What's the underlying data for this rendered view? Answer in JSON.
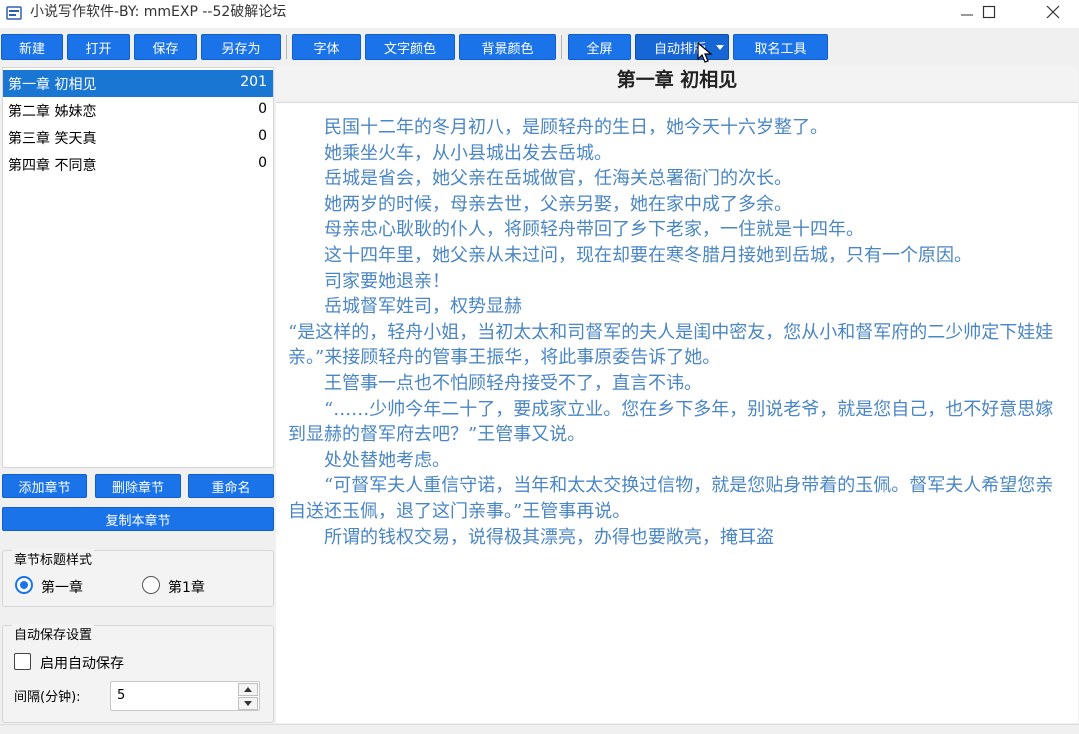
{
  "window": {
    "title": "小说写作软件-BY: mmEXP --52破解论坛"
  },
  "toolbar": {
    "new": "新建",
    "open": "打开",
    "save": "保存",
    "save_as": "另存为",
    "font": "字体",
    "text_color": "文字颜色",
    "bg_color": "背景颜色",
    "fullscreen": "全屏",
    "auto_layout": "自动排版",
    "naming_tool": "取名工具"
  },
  "chapters": [
    {
      "title": "第一章 初相见",
      "count": "201",
      "selected": true
    },
    {
      "title": "第二章 姊妹恋",
      "count": "0",
      "selected": false
    },
    {
      "title": "第三章 笑天真",
      "count": "0",
      "selected": false
    },
    {
      "title": "第四章 不同意",
      "count": "0",
      "selected": false
    }
  ],
  "chapter_actions": {
    "add": "添加章节",
    "delete": "删除章节",
    "rename": "重命名",
    "copy": "复制本章节"
  },
  "title_style": {
    "label": "章节标题样式",
    "option1": "第一章",
    "option2": "第1章",
    "selected": "第一章"
  },
  "autosave": {
    "label": "自动保存设置",
    "enable_label": "启用自动保存",
    "enabled": false,
    "interval_label": "间隔(分钟):",
    "interval_value": "5"
  },
  "editor": {
    "chapter_title": "第一章  初相见",
    "paragraphs": [
      "　　民国十二年的冬月初八，是顾轻舟的生日，她今天十六岁整了。",
      "　　她乘坐火车，从小县城出发去岳城。",
      "　　岳城是省会，她父亲在岳城做官，任海关总署衙门的次长。",
      "　　她两岁的时候，母亲去世，父亲另娶，她在家中成了多余。",
      "　　母亲忠心耿耿的仆人，将顾轻舟带回了乡下老家，一住就是十四年。",
      "　　这十四年里，她父亲从未过问，现在却要在寒冬腊月接她到岳城，只有一个原因。",
      "　　司家要她退亲！",
      "　　岳城督军姓司，权势显赫",
      "“是这样的，轻舟小姐，当初太太和司督军的夫人是闺中密友，您从小和督军府的二少帅定下娃娃亲。”来接顾轻舟的管事王振华，将此事原委告诉了她。",
      "　　王管事一点也不怕顾轻舟接受不了，直言不讳。",
      "　　“……少帅今年二十了，要成家立业。您在乡下多年，别说老爷，就是您自己，也不好意思嫁到显赫的督军府去吧？”王管事又说。",
      "　　处处替她考虑。",
      "　　“可督军夫人重信守诺，当年和太太交换过信物，就是您贴身带着的玉佩。督军夫人希望您亲自送还玉佩，退了这门亲事。”王管事再说。",
      "　　所谓的钱权交易，说得极其漂亮，办得也要敞亮，掩耳盗"
    ]
  }
}
